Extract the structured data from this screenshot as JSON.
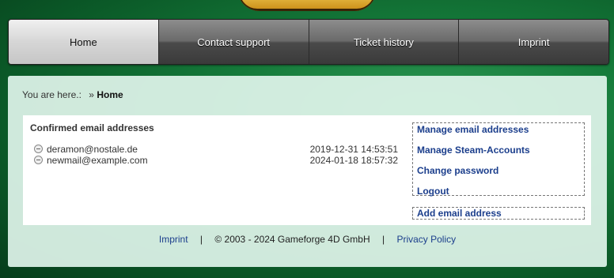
{
  "nav": {
    "items": [
      {
        "label": "Home",
        "active": true
      },
      {
        "label": "Contact support",
        "active": false
      },
      {
        "label": "Ticket history",
        "active": false
      },
      {
        "label": "Imprint",
        "active": false
      }
    ]
  },
  "breadcrumb": {
    "prefix": "You are here.:",
    "separator": "»",
    "current": "Home"
  },
  "emails": {
    "title": "Confirmed email addresses",
    "rows": [
      {
        "address": "deramon@nostale.de",
        "date": "2019-12-31 14:53:51"
      },
      {
        "address": "newmail@example.com",
        "date": "2024-01-18 18:57:32"
      }
    ]
  },
  "menu": {
    "items": [
      "Manage email addresses",
      "Manage Steam-Accounts",
      "Change password",
      "Logout"
    ],
    "add_label": "Add email address"
  },
  "footer": {
    "imprint": "Imprint",
    "divider": "|",
    "copyright": "© 2003 - 2024 Gameforge 4D GmbH",
    "privacy": "Privacy Policy"
  },
  "colors": {
    "link": "#1b3e8c",
    "background": "#157a3a"
  }
}
